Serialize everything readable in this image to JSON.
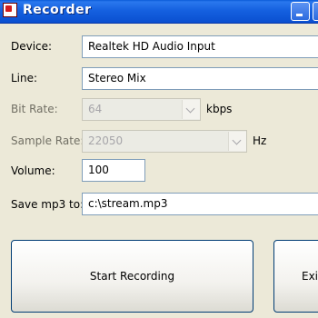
{
  "window": {
    "title": "Recorder"
  },
  "form": {
    "device": {
      "label": "Device:",
      "value": "Realtek HD Audio Input"
    },
    "line": {
      "label": "Line:",
      "value": "Stereo Mix"
    },
    "bitrate": {
      "label": "Bit Rate:",
      "value": "64",
      "unit": "kbps"
    },
    "samplerate": {
      "label": "Sample Rate:",
      "value": "22050",
      "unit": "Hz"
    },
    "volume": {
      "label": "Volume:",
      "value": "100"
    },
    "savemp3": {
      "label": "Save mp3 to:",
      "value": "c:\\stream.mp3"
    }
  },
  "buttons": {
    "start": "Start Recording",
    "exit": "Exit"
  }
}
